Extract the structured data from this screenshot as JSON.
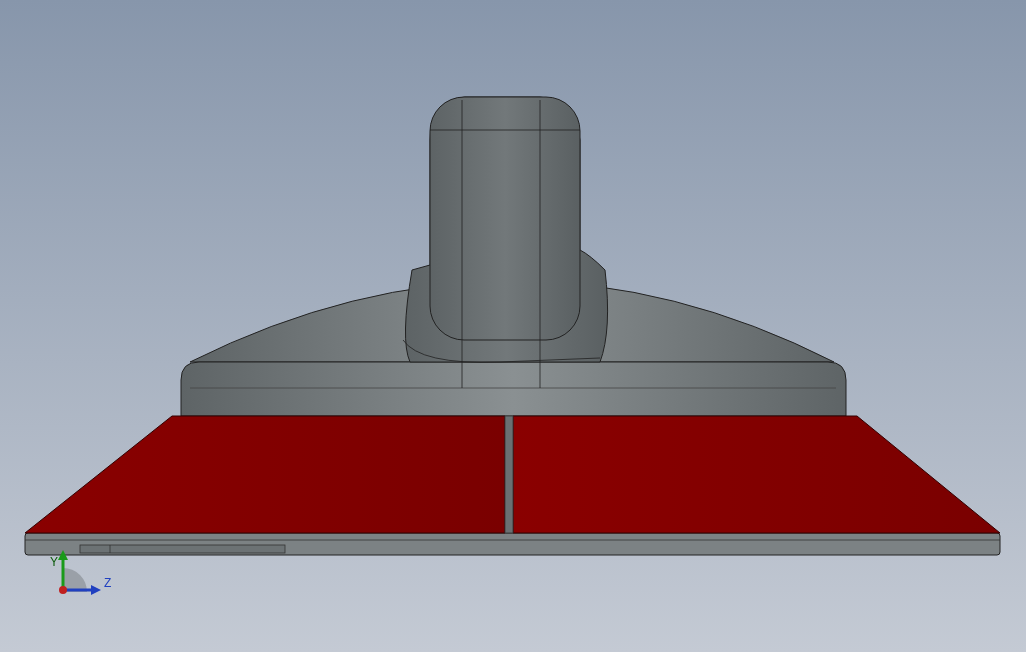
{
  "viewport": {
    "triad": {
      "axes": [
        {
          "label": "Y",
          "kind": "y"
        },
        {
          "label": "Z",
          "kind": "z"
        }
      ]
    }
  }
}
